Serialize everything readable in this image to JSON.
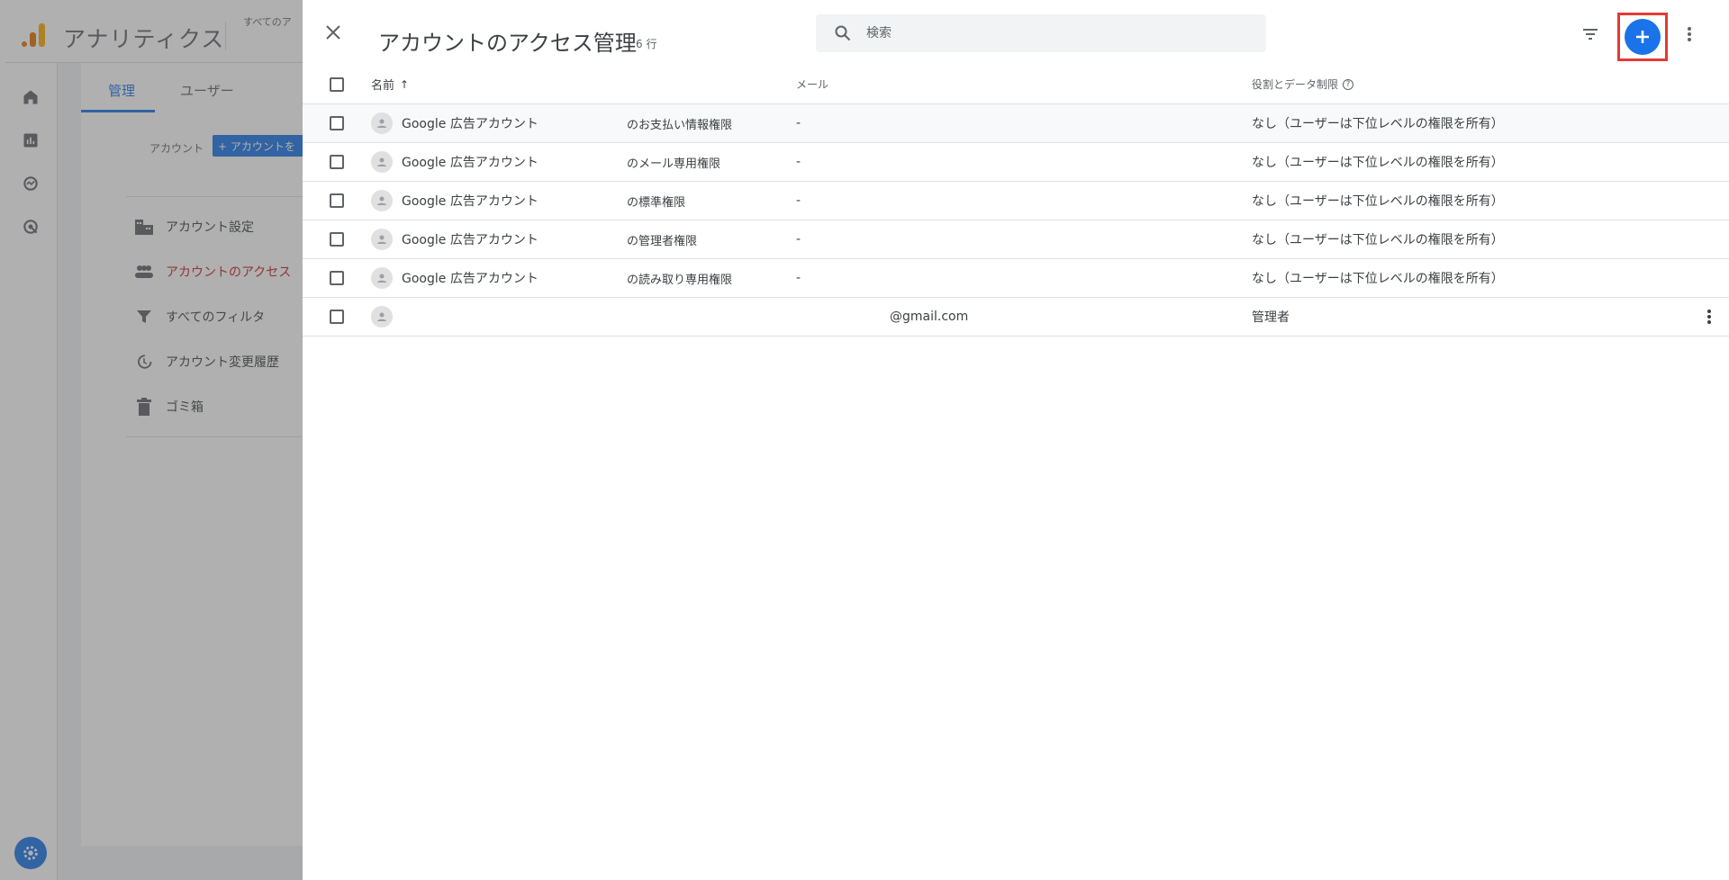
{
  "app": {
    "title": "アナリティクス",
    "breadcrumb": "すべてのア"
  },
  "admin": {
    "tabs": [
      {
        "label": "管理"
      },
      {
        "label": "ユーザー"
      }
    ],
    "account_label": "アカウント",
    "create_account_label": "+ アカウントを",
    "menu": [
      {
        "label": "アカウント設定",
        "icon": "building-icon"
      },
      {
        "label": "アカウントのアクセス",
        "icon": "people-icon"
      },
      {
        "label": "すべてのフィルタ",
        "icon": "filter-icon"
      },
      {
        "label": "アカウント変更履歴",
        "icon": "history-icon"
      },
      {
        "label": "ゴミ箱",
        "icon": "trash-icon"
      }
    ]
  },
  "drawer": {
    "title": "アカウントのアクセス管理",
    "row_count": "6 行",
    "search_placeholder": "検索"
  },
  "table": {
    "headers": {
      "name": "名前",
      "sort": "↑",
      "email": "メール",
      "role": "役割とデータ制限"
    },
    "rows": [
      {
        "name": "Google 広告アカウント",
        "suffix": "のお支払い情報権限",
        "email": "-",
        "role": "なし（ユーザーは下位レベルの権限を所有）"
      },
      {
        "name": "Google 広告アカウント",
        "suffix": "のメール専用権限",
        "email": "-",
        "role": "なし（ユーザーは下位レベルの権限を所有）"
      },
      {
        "name": "Google 広告アカウント",
        "suffix": "の標準権限",
        "email": "-",
        "role": "なし（ユーザーは下位レベルの権限を所有）"
      },
      {
        "name": "Google 広告アカウント",
        "suffix": "の管理者権限",
        "email": "-",
        "role": "なし（ユーザーは下位レベルの権限を所有）"
      },
      {
        "name": "Google 広告アカウント",
        "suffix": "の読み取り専用権限",
        "email": "-",
        "role": "なし（ユーザーは下位レベルの権限を所有）"
      },
      {
        "name": "",
        "suffix": "",
        "email": "@gmail.com",
        "role": "管理者"
      }
    ]
  },
  "colors": {
    "accent": "#1a73e8",
    "highlight": "#e53935",
    "active_menu": "#c5221f"
  }
}
